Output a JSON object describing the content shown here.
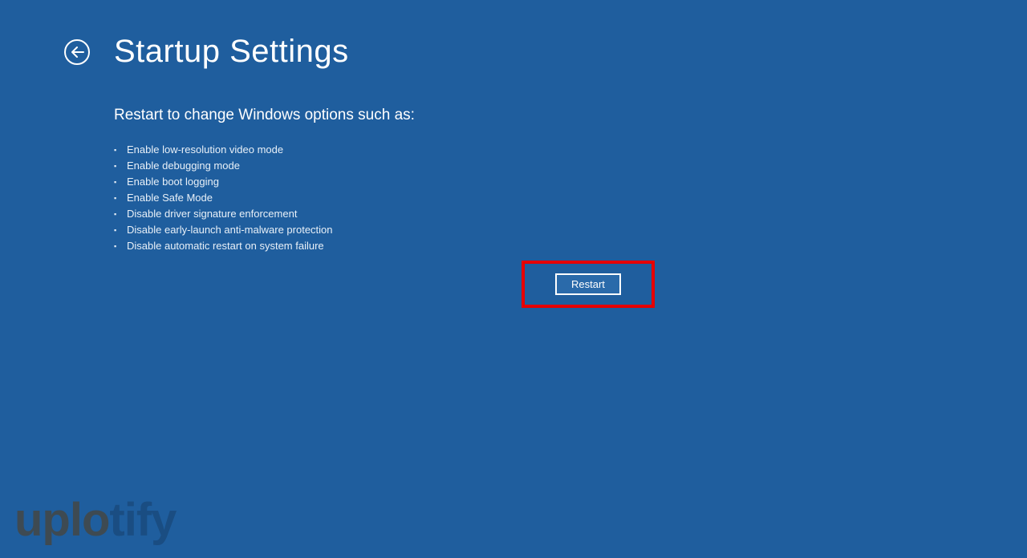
{
  "header": {
    "title": "Startup Settings"
  },
  "content": {
    "subtitle": "Restart to change Windows options such as:",
    "options": [
      "Enable low-resolution video mode",
      "Enable debugging mode",
      "Enable boot logging",
      "Enable Safe Mode",
      "Disable driver signature enforcement",
      "Disable early-launch anti-malware protection",
      "Disable automatic restart on system failure"
    ]
  },
  "actions": {
    "restart_label": "Restart"
  },
  "watermark": {
    "part1": "uplo",
    "part2": "tify"
  }
}
